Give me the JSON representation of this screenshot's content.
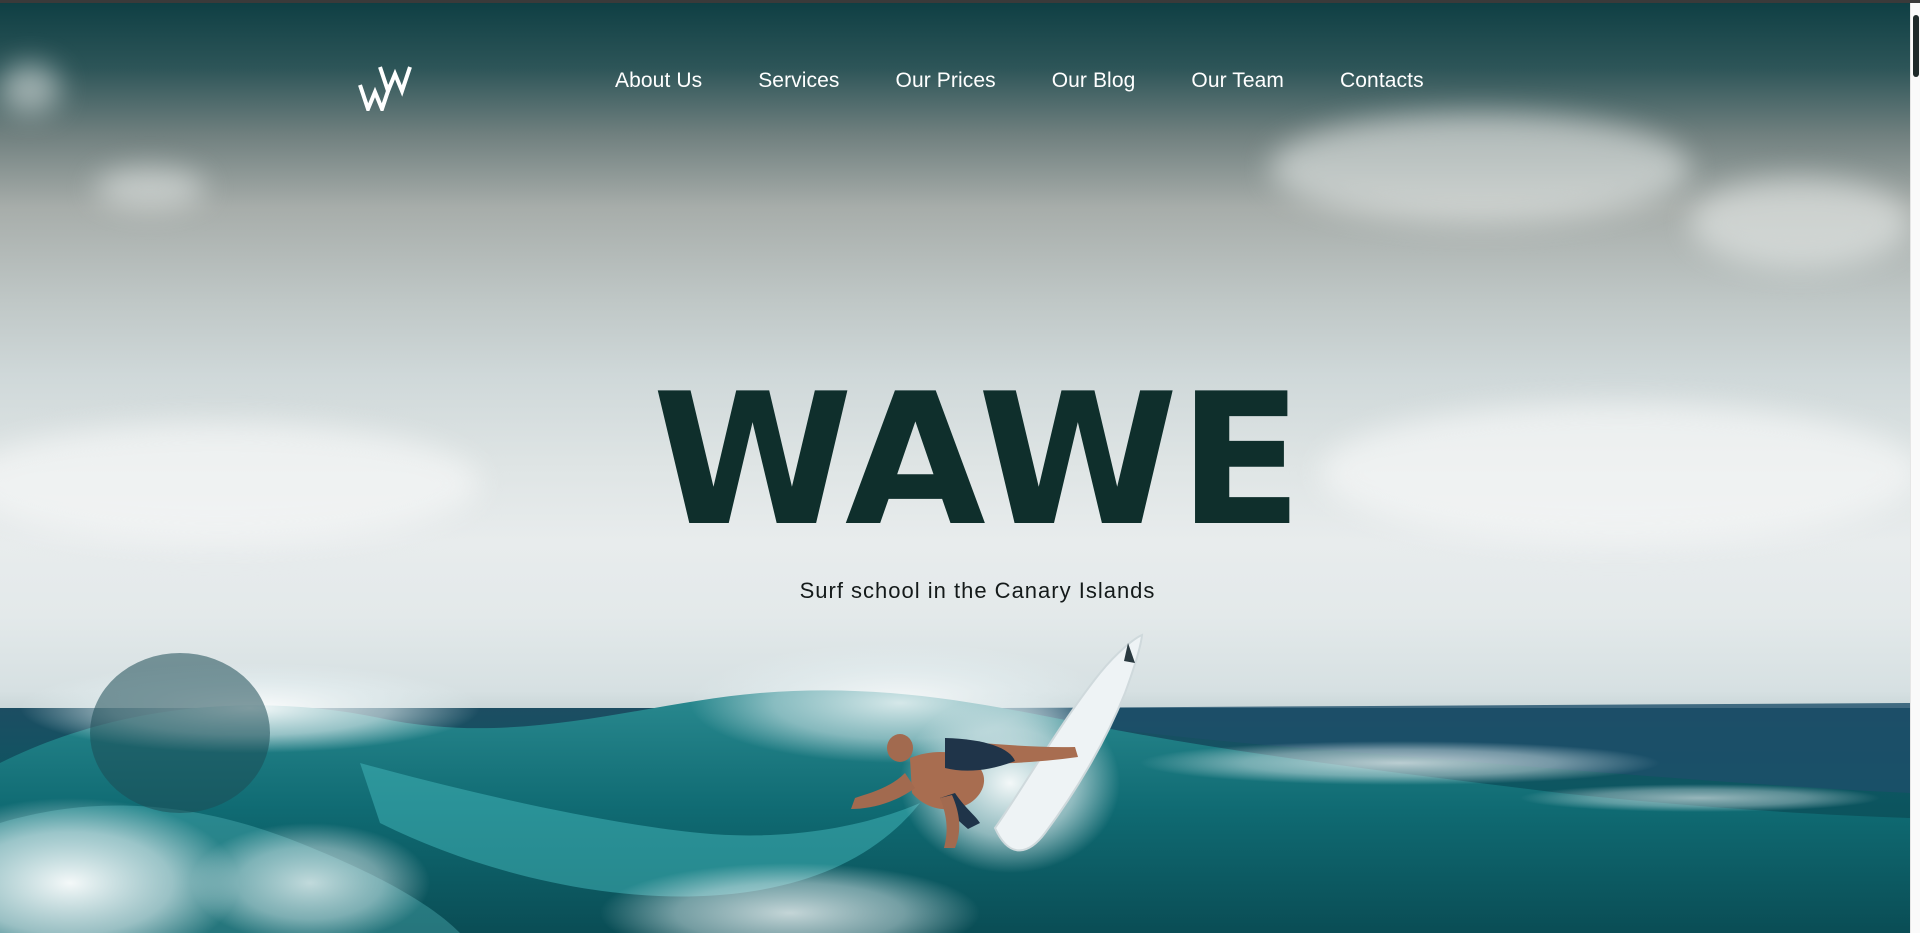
{
  "brand": {
    "logo_icon": "double-w-logo-icon"
  },
  "nav": {
    "items": [
      {
        "label": "About Us"
      },
      {
        "label": "Services"
      },
      {
        "label": "Our Prices"
      },
      {
        "label": "Our Blog"
      },
      {
        "label": "Our Team"
      },
      {
        "label": "Contacts"
      }
    ]
  },
  "hero": {
    "title": "WAWE",
    "subtitle": "Surf school in the Canary Islands",
    "background_image": "surfer-riding-ocean-wave"
  },
  "colors": {
    "title": "#0f2f2c",
    "nav_text": "#ffffff",
    "sky_top": "#0f3f44",
    "sea_deep": "#0b4a55",
    "sea_teal": "#167f85"
  }
}
